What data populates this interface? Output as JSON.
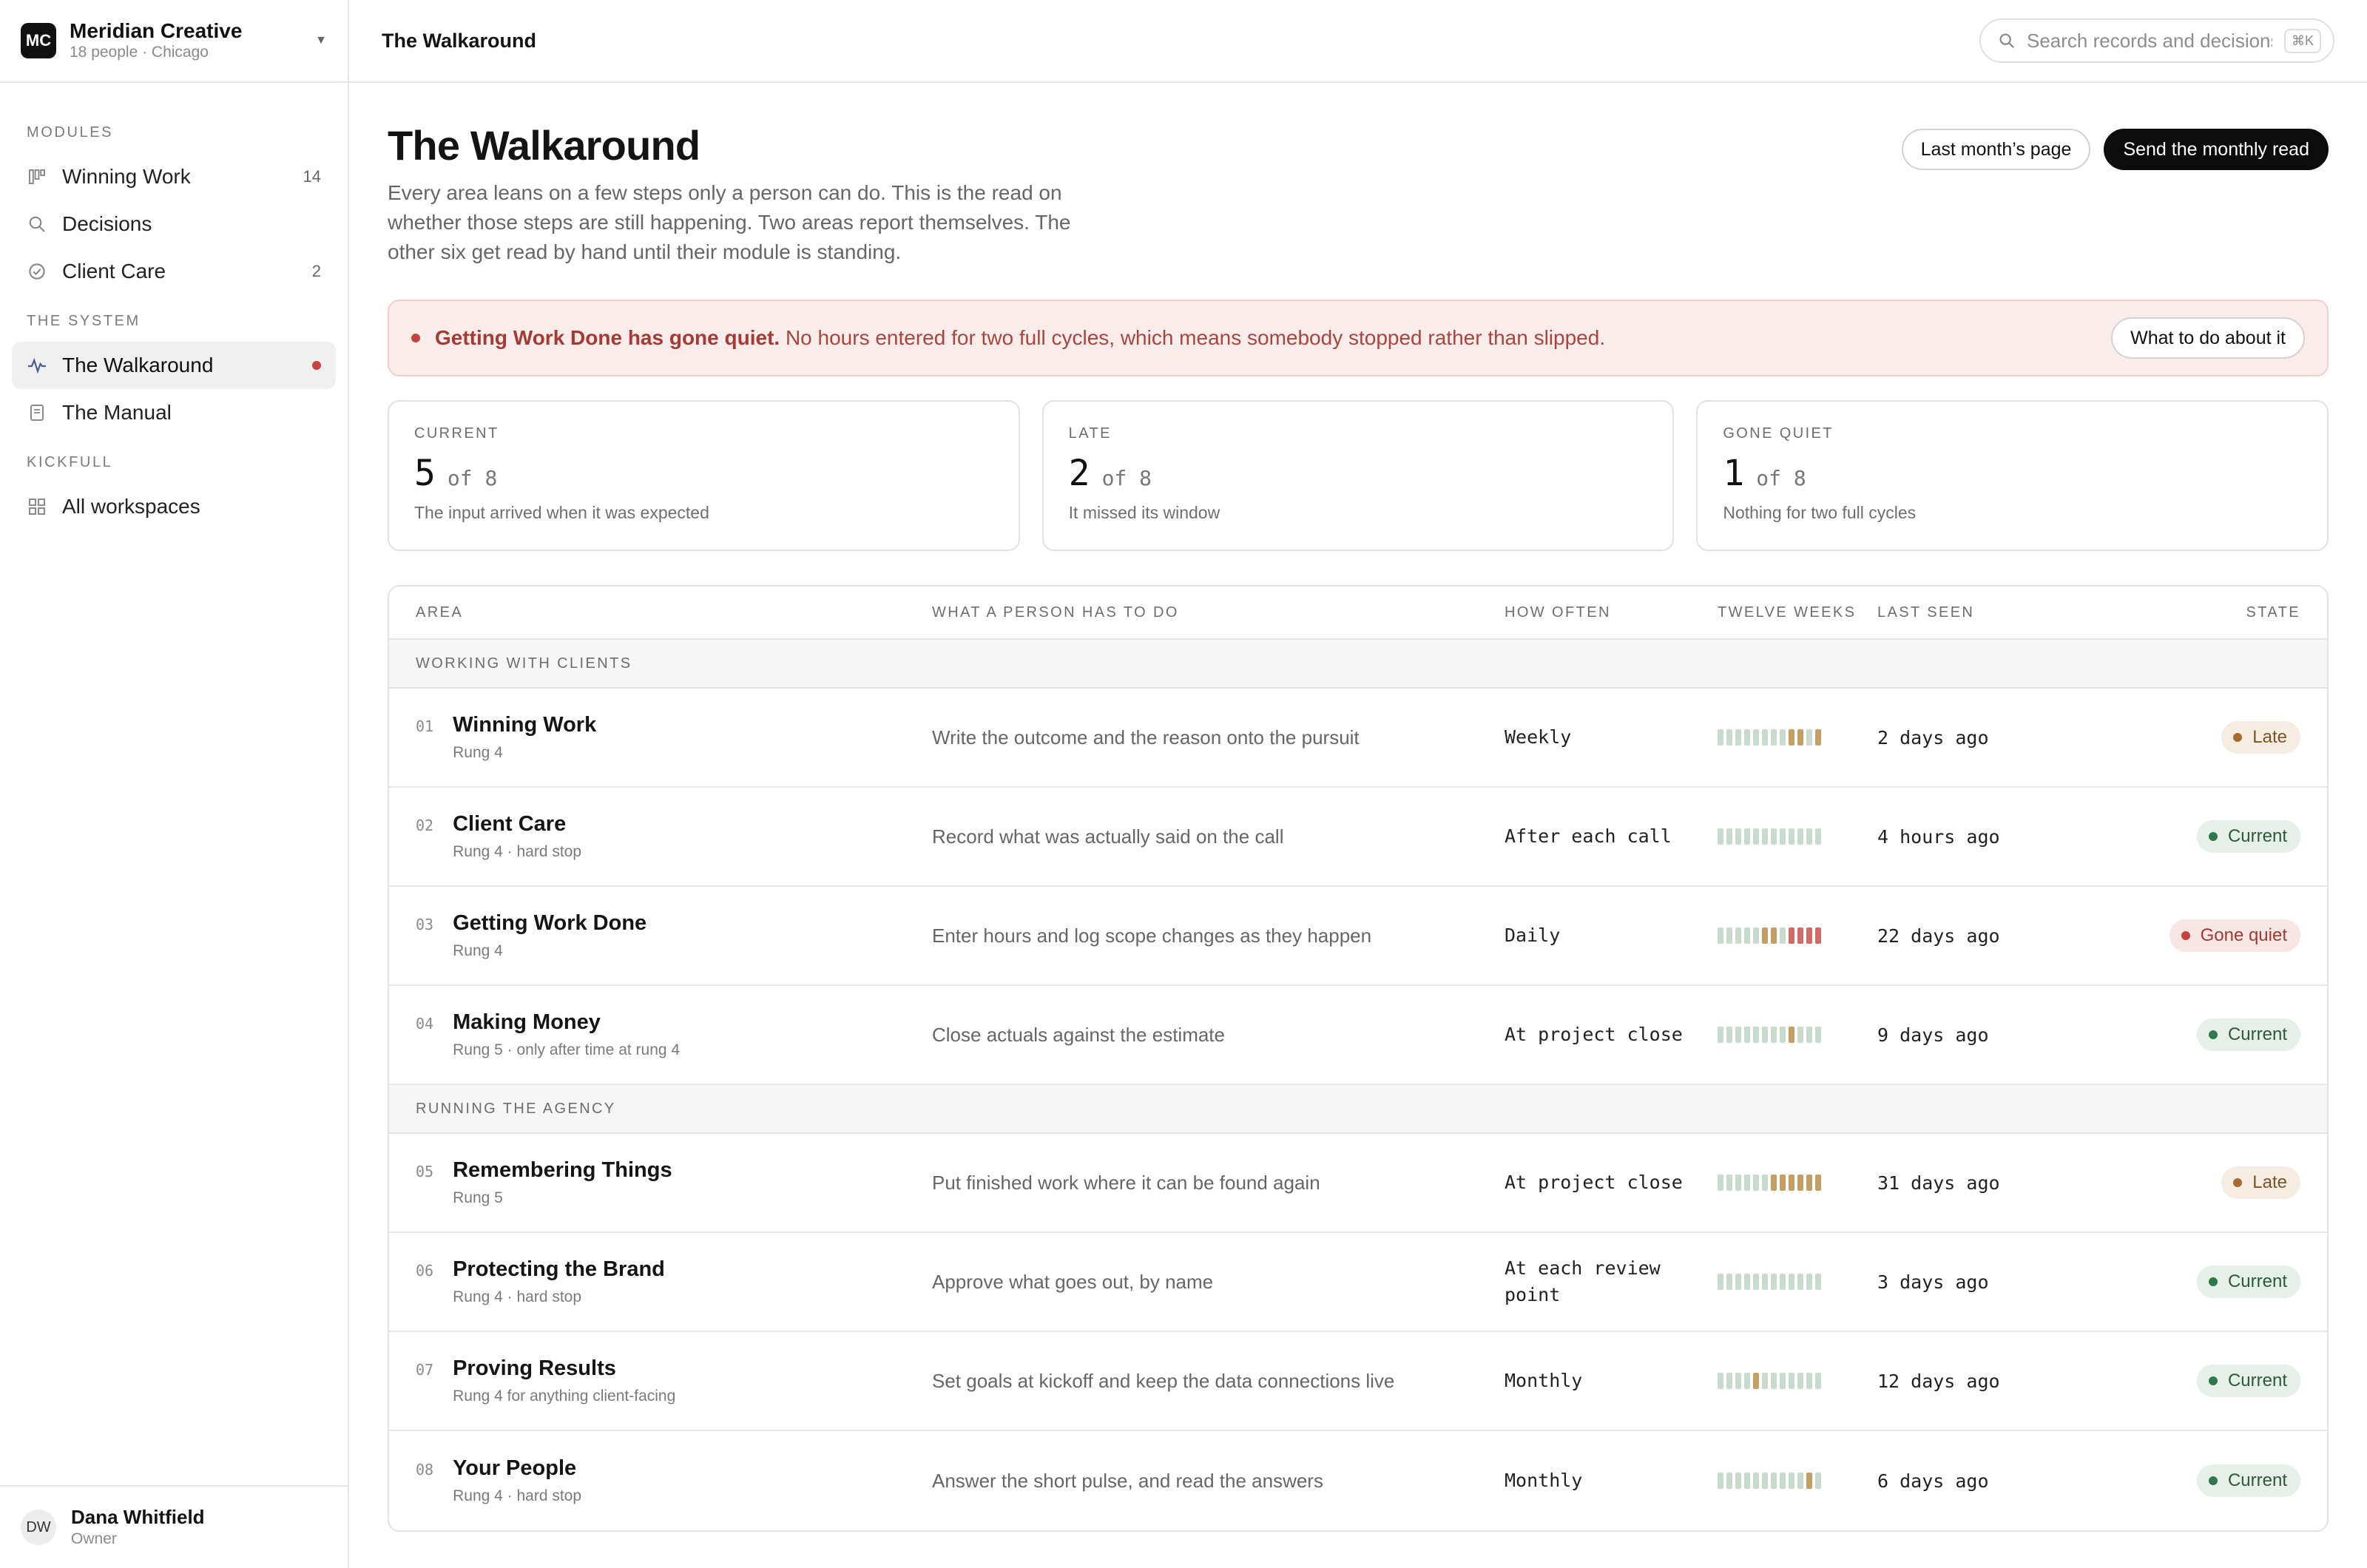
{
  "workspace": {
    "initials": "MC",
    "name": "Meridian Creative",
    "meta": "18 people · Chicago"
  },
  "sidebar": {
    "sections": [
      {
        "heading": "MODULES",
        "items": [
          {
            "label": "Winning Work",
            "icon": "columns-icon",
            "count": "14"
          },
          {
            "label": "Decisions",
            "icon": "search-icon",
            "count": ""
          },
          {
            "label": "Client Care",
            "icon": "check-circle-icon",
            "count": "2"
          }
        ]
      },
      {
        "heading": "THE SYSTEM",
        "items": [
          {
            "label": "The Walkaround",
            "icon": "pulse-icon",
            "active": true,
            "alert": true
          },
          {
            "label": "The Manual",
            "icon": "document-icon"
          }
        ]
      },
      {
        "heading": "KICKFULL",
        "items": [
          {
            "label": "All workspaces",
            "icon": "grid-icon"
          }
        ]
      }
    ]
  },
  "user": {
    "initials": "DW",
    "name": "Dana Whitfield",
    "role": "Owner"
  },
  "topbar": {
    "title": "The Walkaround",
    "search_placeholder": "Search records and decisions",
    "shortcut": "⌘K"
  },
  "page": {
    "title": "The Walkaround",
    "intro": "Every area leans on a few steps only a person can do. This is the read on whether those steps are still happening. Two areas report themselves. The other six get read by hand until their module is standing.",
    "buttons": {
      "secondary": "Last month’s page",
      "primary": "Send the monthly read"
    }
  },
  "alert": {
    "strong": "Getting Work Done has gone quiet.",
    "text": " No hours entered for two full cycles, which means somebody stopped rather than slipped.",
    "action": "What to do about it",
    "color": "#c3443d"
  },
  "stats": [
    {
      "label": "CURRENT",
      "value": "5",
      "of": "of 8",
      "note": "The input arrived when it was expected"
    },
    {
      "label": "LATE",
      "value": "2",
      "of": "of 8",
      "note": "It missed its window"
    },
    {
      "label": "GONE QUIET",
      "value": "1",
      "of": "of 8",
      "note": "Nothing for two full cycles"
    }
  ],
  "table": {
    "columns": [
      "AREA",
      "WHAT A PERSON HAS TO DO",
      "HOW OFTEN",
      "TWELVE WEEKS",
      "LAST SEEN",
      "STATE"
    ],
    "groups": [
      {
        "name": "WORKING WITH CLIENTS",
        "rows": [
          {
            "num": "01",
            "area": "Winning Work",
            "sub": "Rung 4",
            "task": "Write the outcome and the reason onto the pursuit",
            "freq": "Weekly",
            "weeks": [
              "c",
              "c",
              "c",
              "c",
              "c",
              "c",
              "c",
              "c",
              "l",
              "l",
              "c",
              "l"
            ],
            "seen": "2 days ago",
            "state": "Late",
            "state_kind": "late"
          },
          {
            "num": "02",
            "area": "Client Care",
            "sub": "Rung 4 · hard stop",
            "task": "Record what was actually said on the call",
            "freq": "After each call",
            "weeks": [
              "c",
              "c",
              "c",
              "c",
              "c",
              "c",
              "c",
              "c",
              "c",
              "c",
              "c",
              "c"
            ],
            "seen": "4 hours ago",
            "state": "Current",
            "state_kind": "current"
          },
          {
            "num": "03",
            "area": "Getting Work Done",
            "sub": "Rung 4",
            "task": "Enter hours and log scope changes as they happen",
            "freq": "Daily",
            "weeks": [
              "c",
              "c",
              "c",
              "c",
              "c",
              "l",
              "l",
              "c",
              "g",
              "g",
              "g",
              "g"
            ],
            "seen": "22 days ago",
            "state": "Gone quiet",
            "state_kind": "gone"
          },
          {
            "num": "04",
            "area": "Making Money",
            "sub": "Rung 5 · only after time at rung 4",
            "task": "Close actuals against the estimate",
            "freq": "At project close",
            "weeks": [
              "c",
              "c",
              "c",
              "c",
              "c",
              "c",
              "c",
              "c",
              "l",
              "c",
              "c",
              "c"
            ],
            "seen": "9 days ago",
            "state": "Current",
            "state_kind": "current"
          }
        ]
      },
      {
        "name": "RUNNING THE AGENCY",
        "rows": [
          {
            "num": "05",
            "area": "Remembering Things",
            "sub": "Rung 5",
            "task": "Put finished work where it can be found again",
            "freq": "At project close",
            "weeks": [
              "c",
              "c",
              "c",
              "c",
              "c",
              "c",
              "l",
              "l",
              "l",
              "l",
              "l",
              "l"
            ],
            "seen": "31 days ago",
            "state": "Late",
            "state_kind": "late"
          },
          {
            "num": "06",
            "area": "Protecting the Brand",
            "sub": "Rung 4 · hard stop",
            "task": "Approve what goes out, by name",
            "freq": "At each review point",
            "weeks": [
              "c",
              "c",
              "c",
              "c",
              "c",
              "c",
              "c",
              "c",
              "c",
              "c",
              "c",
              "c"
            ],
            "seen": "3 days ago",
            "state": "Current",
            "state_kind": "current"
          },
          {
            "num": "07",
            "area": "Proving Results",
            "sub": "Rung 4 for anything client-facing",
            "task": "Set goals at kickoff and keep the data connections live",
            "freq": "Monthly",
            "weeks": [
              "c",
              "c",
              "c",
              "c",
              "l",
              "c",
              "c",
              "c",
              "c",
              "c",
              "c",
              "c"
            ],
            "seen": "12 days ago",
            "state": "Current",
            "state_kind": "current"
          },
          {
            "num": "08",
            "area": "Your People",
            "sub": "Rung 4 · hard stop",
            "task": "Answer the short pulse, and read the answers",
            "freq": "Monthly",
            "weeks": [
              "c",
              "c",
              "c",
              "c",
              "c",
              "c",
              "c",
              "c",
              "c",
              "c",
              "l",
              "c"
            ],
            "seen": "6 days ago",
            "state": "Current",
            "state_kind": "current"
          }
        ]
      }
    ]
  },
  "colors": {
    "current": "#2e7a4c",
    "late": "#a66a2e",
    "gone": "#c3443d",
    "week_ok": "#c9dbcd",
    "week_late": "#c39f63",
    "week_gone": "#cf6b62"
  }
}
